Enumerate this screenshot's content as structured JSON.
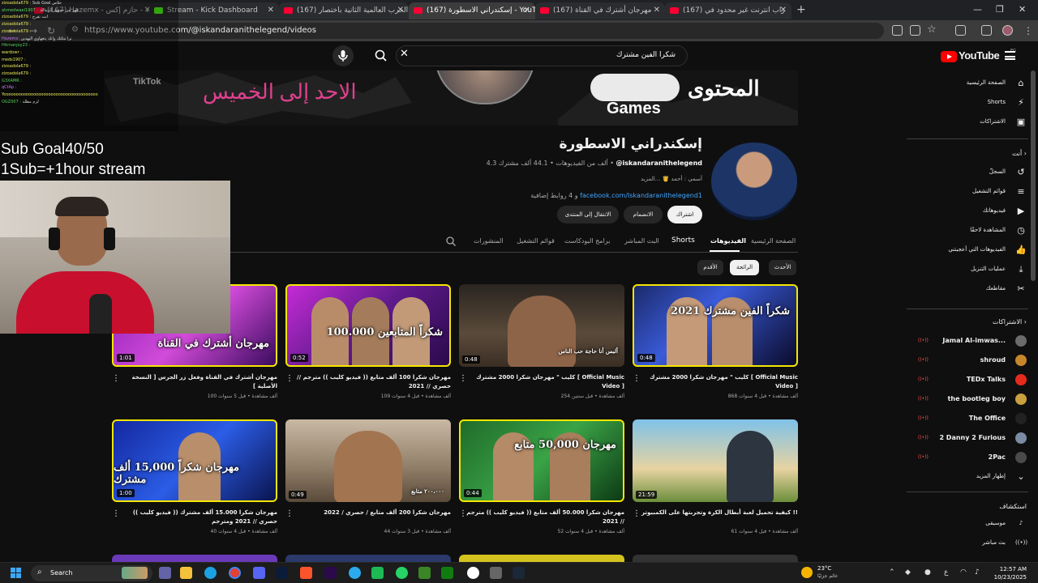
{
  "browser": {
    "tabs": [
      {
        "label": "(167) Hazemx - حازم إكس - YouT",
        "kind": "yt"
      },
      {
        "label": "Stream - Kick Dashboard",
        "kind": "kick"
      },
      {
        "label": "(167) الحرب العالمية الثانية باختصار",
        "kind": "yt"
      },
      {
        "label": "(167) إسكندراني الاسطورة - YouTube",
        "kind": "yt"
      },
      {
        "label": "(167) مهرجان أشترك في القناة",
        "kind": "yt"
      },
      {
        "label": "(167) راب انترنت غير محدود في",
        "kind": "yt"
      }
    ],
    "url": "https://www.youtube.com/@iskandaranithelegend/videos"
  },
  "youtube": {
    "logo": "YouTube",
    "logo_region": "EG",
    "search_value": "شكرا الفين مشترك",
    "banner": {
      "tiktok": "TikTok",
      "mid": "الاحد إلى الخميس",
      "games": "Games",
      "content": "المحتوى"
    },
    "channel": {
      "name": "إسكندراني الاسطورة",
      "handle": "@iskandaranithelegend",
      "subs": "44.1 ألف مشترك",
      "videos": "4.3 ألف من الفيديوهات",
      "desc": "أسمي : أحمد 🤴 ...المزيد",
      "link_text": "facebook.com/Iskandaranithelegend1",
      "link_more": "و 4 روابط إضافية",
      "subscribe": "اشتراك",
      "join": "الانضمام",
      "forum": "الانتقال إلى المنتدى"
    },
    "tabs": [
      "الصفحة الرئيسية",
      "الفيديوهات",
      "Shorts",
      "البث المباشر",
      "برامج البودكاست",
      "قوائم التشغيل",
      "المنشورات"
    ],
    "chips": [
      "الأحدث",
      "الرائجة",
      "الأقدم"
    ],
    "videos": [
      {
        "title": "كليب \" مهرجان شكرا 2000 مشترك [ Official Music Video ]",
        "meta": "868 ألف مشاهدة • قبل 4 سنوات",
        "dur": "0:48"
      },
      {
        "title": "كليب \" مهرجان شكرا 2000 مشترك [ Official Music Video ]",
        "meta": "254 ألف مشاهدة • قبل سنتين",
        "dur": "0:48"
      },
      {
        "title": "مهرجان شكرا 100 ألف متابع (( فيديو كليب )) مترجم // حصري // 2021",
        "meta": "109 ألف مشاهدة • قبل 4 سنوات",
        "dur": "0:52"
      },
      {
        "title": "مهرجان أشترك في القناة وفعل زر الجرس [ النسخة الأصلية ]",
        "meta": "100 ألف مشاهدة • قبل 5 سنوات",
        "dur": "1:01"
      },
      {
        "title": "كيفية تحميل لعبة أبطال الكرة وتجربتها على الكمبيوتر !!",
        "meta": "61 ألف مشاهدة • قبل 4 سنوات",
        "dur": "21:59"
      },
      {
        "title": "مهرجان شكرا 50.000 ألف متابع (( فيديو كليب )) مترجم // 2021",
        "meta": "52 ألف مشاهدة • قبل 4 سنوات",
        "dur": "0:44"
      },
      {
        "title": "مهرجان شكرا 200 ألف متابع / حصري / 2022",
        "meta": "44 ألف مشاهدة • قبل 3 سنوات",
        "dur": "0:49"
      },
      {
        "title": "مهرجان شكرا 15.000 ألف مشترك (( فيديو كليب )) حصري // 2021 ومترجم",
        "meta": "40 ألف مشاهدة • قبل 4 سنوات",
        "dur": "1:00"
      }
    ],
    "thumb_text": [
      "2021 شكراً الفين مشترك",
      "ألبس أنا حاجة حب الناس",
      "100.000 شكراً المتابعين",
      "مهرجان أشترك في القناة",
      "",
      "مهرجان 50,000 متابع",
      "٢٠٠،٠٠٠ متابع",
      "مهرجان شكراً 15,000 ألف مشترك"
    ],
    "sidebar": {
      "main": [
        {
          "label": "الصفحة الرئيسية",
          "icon": "home-icon",
          "glyph": "⌂"
        },
        {
          "label": "Shorts",
          "icon": "shorts-icon",
          "glyph": "⚡"
        },
        {
          "label": "الاشتراكات",
          "icon": "subscriptions-icon",
          "glyph": "▣"
        }
      ],
      "you_header": "أنت",
      "you": [
        {
          "label": "السجلّ",
          "icon": "history-icon",
          "glyph": "↺"
        },
        {
          "label": "قوائم التشغيل",
          "icon": "playlists-icon",
          "glyph": "≡"
        },
        {
          "label": "فيديوهاتك",
          "icon": "your-videos-icon",
          "glyph": "▶"
        },
        {
          "label": "المشاهدة لاحقًا",
          "icon": "watch-later-icon",
          "glyph": "◷"
        },
        {
          "label": "الفيديوهات التي أعجبتني",
          "icon": "liked-icon",
          "glyph": "👍"
        },
        {
          "label": "عمليات التنزيل",
          "icon": "download-icon",
          "glyph": "⤓"
        },
        {
          "label": "مقاطعك",
          "icon": "clips-icon",
          "glyph": "✂"
        }
      ],
      "subs_header": "الاشتراكات",
      "subs": [
        {
          "label": "Jamal Al-imwas...",
          "color": "#6b6b6b"
        },
        {
          "label": "shroud",
          "color": "#c8862b"
        },
        {
          "label": "TEDx Talks",
          "color": "#e62b1e"
        },
        {
          "label": "the bootleg boy",
          "color": "#c9a03d"
        },
        {
          "label": "The Office",
          "color": "#222222"
        },
        {
          "label": "2 Danny 2 Furious",
          "color": "#7a8ba3"
        },
        {
          "label": "2Pac",
          "color": "#4a4a4a"
        }
      ],
      "show_more": "إظهار المزيد",
      "explore_header": "استكشاف",
      "explore": [
        {
          "label": "موسيقى",
          "icon": "music-icon",
          "glyph": "♪"
        },
        {
          "label": "بث مباشر",
          "icon": "live-icon",
          "glyph": "((•))"
        }
      ]
    }
  },
  "overlay": {
    "sub_goal": "Sub Goal40/50\n1Sub=+1hour stream",
    "chat": [
      {
        "u": "zizoadola679 :",
        "m": "Sub Goal خلاص",
        "c": ""
      },
      {
        "u": "ahmedwael1907 :",
        "m": "قهر من جمهور الزمالك",
        "c": "g"
      },
      {
        "u": "zizoadola679 :",
        "m": "انت تفرج",
        "c": ""
      },
      {
        "u": "zizoadola679 :",
        "m": "",
        "c": ""
      },
      {
        "u": "zizoadola679 :",
        "m": "",
        "c": ""
      },
      {
        "u": "Hazemx:",
        "m": "ترا مثلثك وانك بثغهاوي اليهدين",
        "c": "p"
      },
      {
        "u": "Hitmanjoy23 :",
        "m": "",
        "c": "g"
      },
      {
        "u": "wardowr :",
        "m": "",
        "c": ""
      },
      {
        "u": "meds1907 :",
        "m": "",
        "c": ""
      },
      {
        "u": "zizoadola679 :",
        "m": "",
        "c": ""
      },
      {
        "u": "zizoadola679 :",
        "m": "",
        "c": ""
      },
      {
        "u": "G3XAMR :",
        "m": "",
        "c": "g"
      },
      {
        "u": "qCtAp :",
        "m": "",
        "c": "p"
      },
      {
        "u": "Yoooooooooooooooooooooooooooooooooooooo",
        "m": "",
        "c": ""
      },
      {
        "u": "OGZ007 :",
        "m": "لزم مظلة",
        "c": "g"
      }
    ]
  },
  "taskbar": {
    "search": "Search",
    "weather_temp": "23°C",
    "weather_desc": "غائم جزئيًا",
    "time": "12:57 AM",
    "date": "10/23/2025",
    "lang": "ع"
  }
}
